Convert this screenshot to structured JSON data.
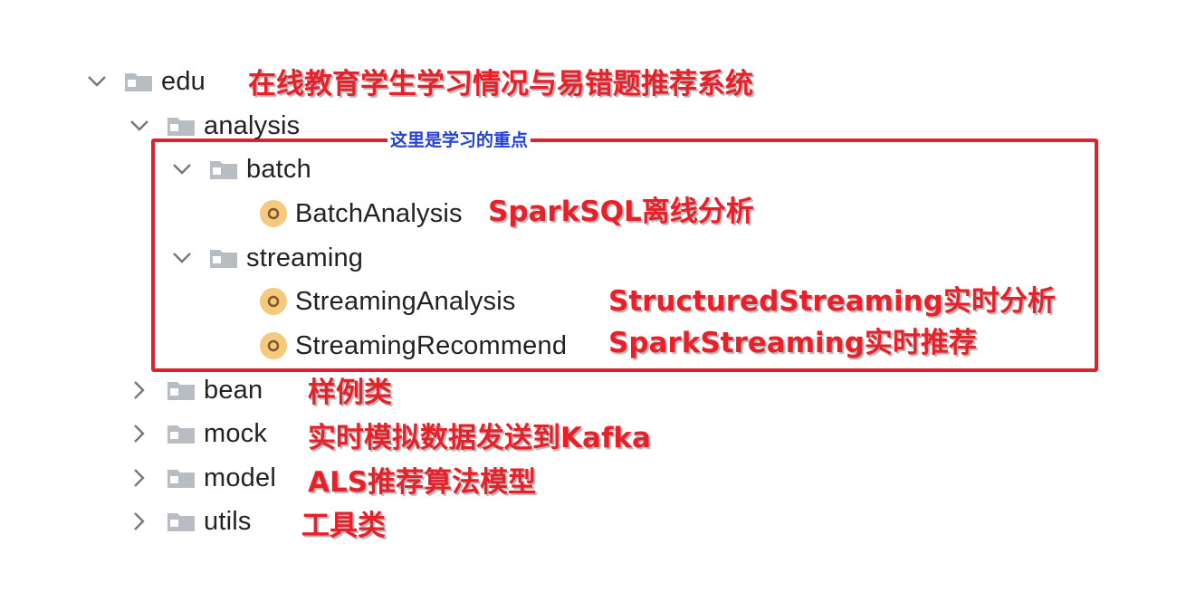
{
  "tree": {
    "edu": {
      "name": "edu",
      "annotation": "在线教育学生学习情况与易错题推荐系统"
    },
    "analysis": {
      "name": "analysis"
    },
    "batch": {
      "name": "batch"
    },
    "batch_analysis": {
      "name": "BatchAnalysis",
      "annotation": "SparkSQL离线分析"
    },
    "streaming": {
      "name": "streaming"
    },
    "streaming_analysis": {
      "name": "StreamingAnalysis",
      "annotation": "StructuredStreaming实时分析"
    },
    "streaming_recommend": {
      "name": "StreamingRecommend",
      "annotation": "SparkStreaming实时推荐"
    },
    "bean": {
      "name": "bean",
      "annotation": "样例类"
    },
    "mock": {
      "name": "mock",
      "annotation": "实时模拟数据发送到Kafka"
    },
    "model": {
      "name": "model",
      "annotation": "ALS推荐算法模型"
    },
    "utils": {
      "name": "utils",
      "annotation": "工具类"
    }
  },
  "highlight": {
    "label": "这里是学习的重点"
  },
  "colors": {
    "annotation": "#e8202a",
    "highlight_border": "#e0202a",
    "highlight_label": "#2340d8",
    "folder": "#b7bdc3",
    "class_icon": "#f5c97e"
  },
  "icons": {
    "expanded": "chevron-down-icon",
    "collapsed": "chevron-right-icon",
    "folder": "folder-icon",
    "class": "class-icon"
  }
}
